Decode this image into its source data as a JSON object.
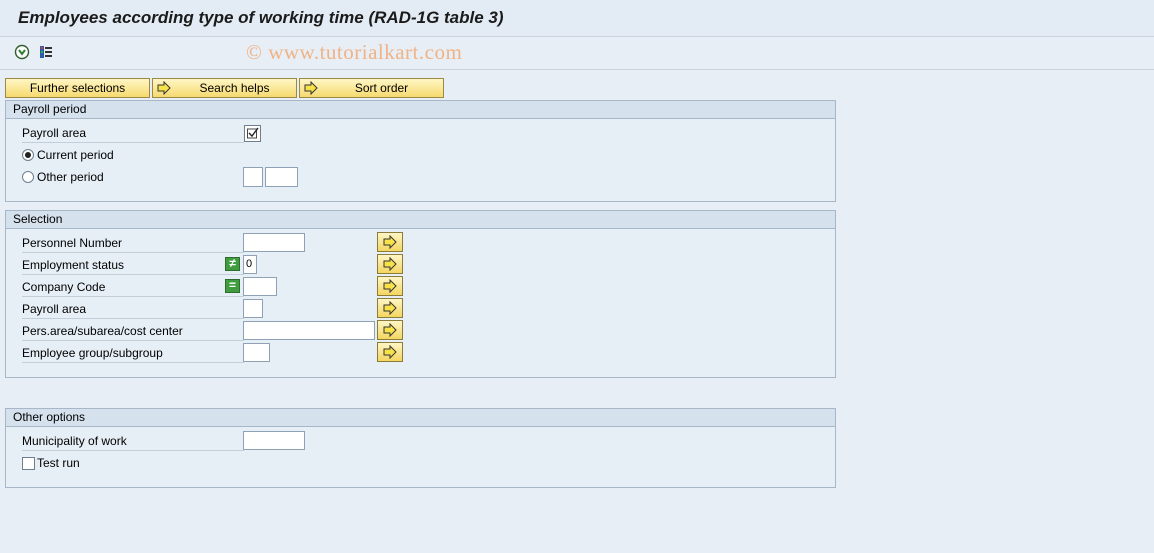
{
  "title": "Employees according type of working time (RAD-1G table 3)",
  "toolbar": {
    "execute_icon": "execute-icon",
    "variants_icon": "variants-icon"
  },
  "watermark": "© www.tutorialkart.com",
  "top_buttons": {
    "further_selections": "Further selections",
    "search_helps": "Search helps",
    "sort_order": "Sort order"
  },
  "payroll_period": {
    "header": "Payroll period",
    "payroll_area_label": "Payroll area",
    "payroll_area_checked": true,
    "current_period_label": "Current period",
    "current_period_selected": true,
    "other_period_label": "Other period",
    "other_period_selected": false,
    "other_period_value_1": "",
    "other_period_value_2": ""
  },
  "selection": {
    "header": "Selection",
    "rows": [
      {
        "label": "Personnel Number",
        "value": ""
      },
      {
        "label": "Employment status",
        "value": "0",
        "operator": "≠"
      },
      {
        "label": "Company Code",
        "value": "",
        "operator": "="
      },
      {
        "label": "Payroll area",
        "value": ""
      },
      {
        "label": "Pers.area/subarea/cost center",
        "value": ""
      },
      {
        "label": "Employee group/subgroup",
        "value": ""
      }
    ]
  },
  "other_options": {
    "header": "Other options",
    "municipality_label": "Municipality of work",
    "municipality_value": "",
    "test_run_label": "Test run",
    "test_run_checked": false
  },
  "colors": {
    "background": "#e7eef5",
    "button_yellow": "#f6da6f",
    "operator_green": "#3f9d3f"
  }
}
